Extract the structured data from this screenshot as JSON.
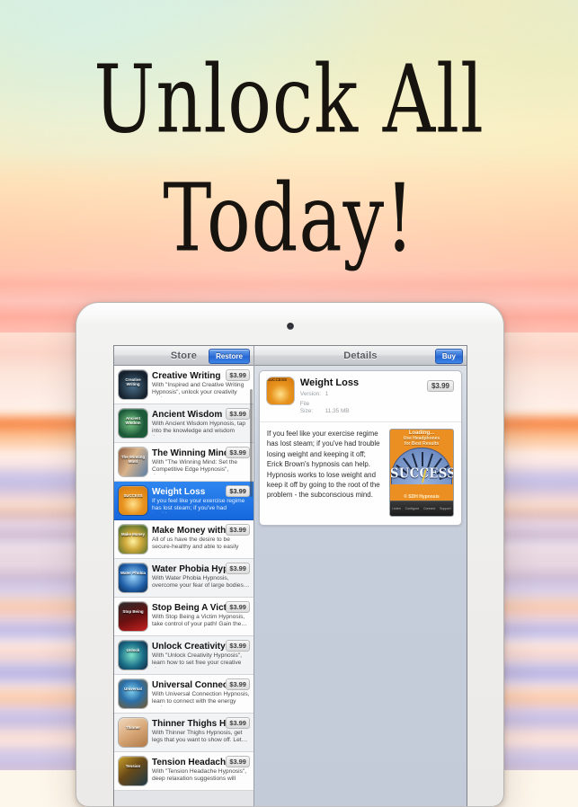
{
  "headline": {
    "line1": "Unlock All",
    "line2": "Today!"
  },
  "colors": {
    "accent_blue": "#2f6fd8",
    "selected_row": "#1f76e8",
    "price_badge": "#dcdcdc",
    "screenshot_orange": "#eb8f22"
  },
  "device": {
    "name": "tablet-device-frame",
    "camera": "front-camera"
  },
  "store_panel": {
    "title": "Store",
    "restore_button": "Restore",
    "items": [
      {
        "title": "Creative Writing",
        "desc": "With \"Inspired and Creative Writing Hypnosis\", unlock your creativity and…",
        "price": "$3.99",
        "icon_label": "Creative Writing",
        "selected": false
      },
      {
        "title": "Ancient Wisdom",
        "desc": "With Ancient Wisdom Hypnosis, tap into the knowledge and wisdom that…",
        "price": "$3.99",
        "icon_label": "Ancient Wisdom",
        "selected": false
      },
      {
        "title": "The Winning Mind",
        "desc": "With \"The Winning Mind: Set the Competitive Edge Hypnosis\", develo…",
        "price": "$3.99",
        "icon_label": "The Winning Mind",
        "selected": false
      },
      {
        "title": "Weight Loss",
        "desc": "If you feel like your exercise regime has lost steam; if you've had trouble…",
        "price": "$3.99",
        "icon_label": "SUCCESS",
        "selected": true
      },
      {
        "title": "Make Money with the L",
        "desc": "All of us have the desire to be secure-healthy and able to easily meet our…",
        "price": "$3.99",
        "icon_label": "Make Money",
        "selected": false
      },
      {
        "title": "Water Phobia Hypnos.",
        "desc": "With Water Phobia Hypnosis, overcome your fear of large bodies…",
        "price": "$3.99",
        "icon_label": "Water Phobia",
        "selected": false
      },
      {
        "title": "Stop Being A Victim",
        "desc": "With Stop Being a Victim Hypnosis, take control of your path! Gain the…",
        "price": "$3.99",
        "icon_label": "Stop Being",
        "selected": false
      },
      {
        "title": "Unlock Creativity",
        "desc": "With \"Unlock Creativity Hypnosis\", learn how to set free your creative si…",
        "price": "$3.99",
        "icon_label": "Unlock",
        "selected": false
      },
      {
        "title": "Universal Connection",
        "desc": "With Universal Connection Hypnosis, learn to connect with the energy and…",
        "price": "$3.99",
        "icon_label": "Universal",
        "selected": false
      },
      {
        "title": "Thinner Thighs Hypno",
        "desc": "With Thinner Thighs Hypnosis, get legs that you want to show off. Let…",
        "price": "$3.99",
        "icon_label": "Thinner",
        "selected": false
      },
      {
        "title": "Tension Headache",
        "desc": "With \"Tension Headache Hypnosis\", deep relaxation suggestions will mas…",
        "price": "$3.99",
        "icon_label": "Tension",
        "selected": false
      }
    ]
  },
  "details_panel": {
    "title": "Details",
    "buy_button": "Buy",
    "app": {
      "name": "Weight Loss",
      "price": "$3.99",
      "version_label": "Version:",
      "version_value": "1",
      "filesize_label": "File Size:",
      "filesize_value": "11.35 MB",
      "description": "If you feel like your exercise regime has lost steam; if you've had trouble losing weight and keeping it off; Erick Brown's hypnosis can help. Hypnosis works to lose weight and keep it off by going to the root of the problem - the subconscious mind."
    },
    "screenshot": {
      "loading_text": "Loading...",
      "headline_line1": "Use Headphones",
      "headline_line2": "for Best Results",
      "gauge_word": "SUCCESS",
      "credit": "© SDH Hypnosis",
      "toolbar": [
        "Listen",
        "Configure",
        "Connect",
        "Support"
      ]
    }
  }
}
